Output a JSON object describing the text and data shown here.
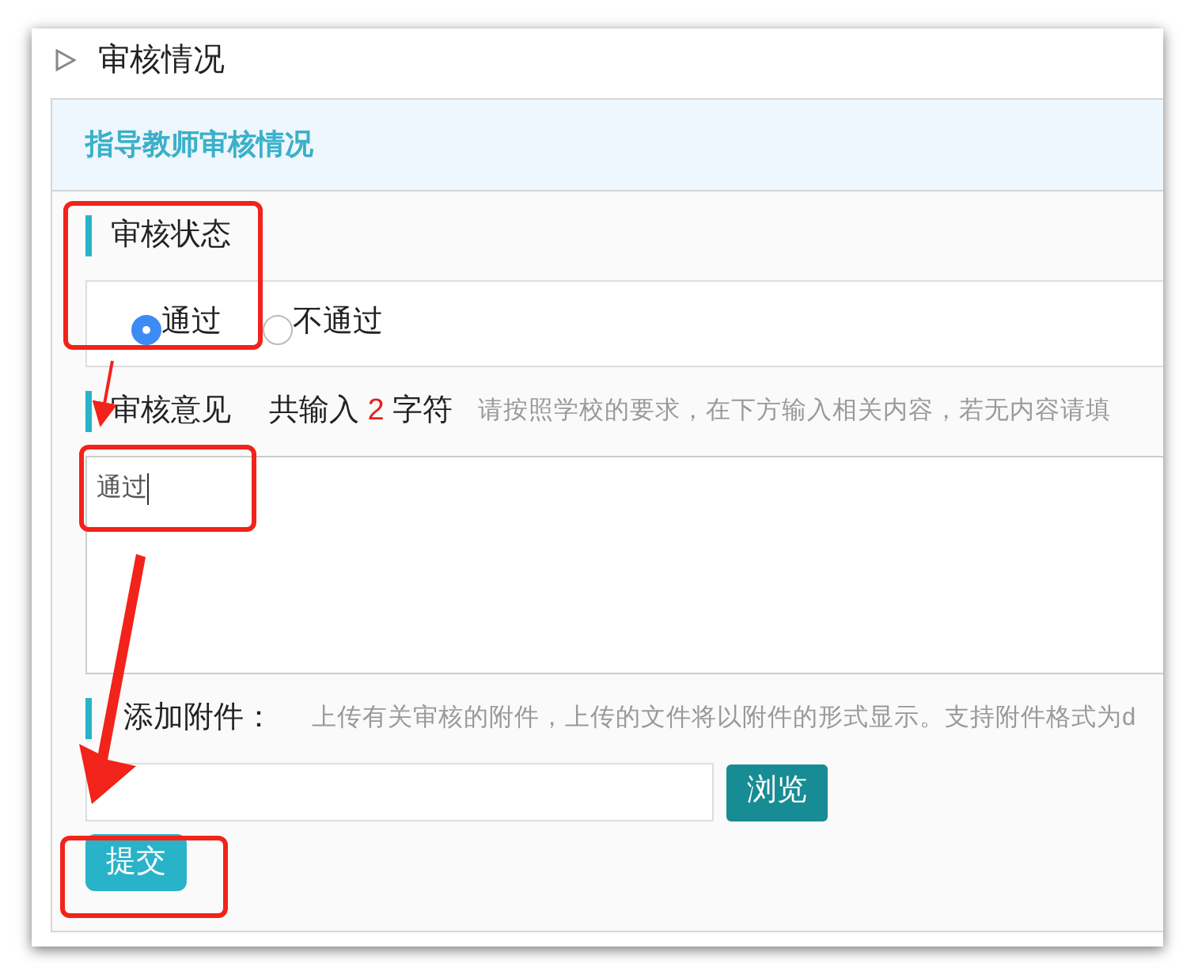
{
  "section": {
    "title": "审核情况"
  },
  "panel": {
    "title": "指导教师审核情况",
    "status": {
      "label": "审核状态",
      "highlighted": true,
      "options": [
        {
          "label": "通过",
          "selected": true
        },
        {
          "label": "不通过",
          "selected": false
        }
      ]
    },
    "opinion": {
      "label": "审核意见",
      "count_prefix": "共输入",
      "count": "2",
      "count_suffix": "字符",
      "hint": "请按照学校的要求，在下方输入相关内容，若无内容请填",
      "value": "通过",
      "highlighted": true
    },
    "attachment": {
      "label": "添加附件：",
      "hint": "上传有关审核的附件，上传的文件将以附件的形式显示。支持附件格式为d",
      "browse_button": "浏览"
    },
    "submit": {
      "label": "提交",
      "highlighted": true
    }
  }
}
